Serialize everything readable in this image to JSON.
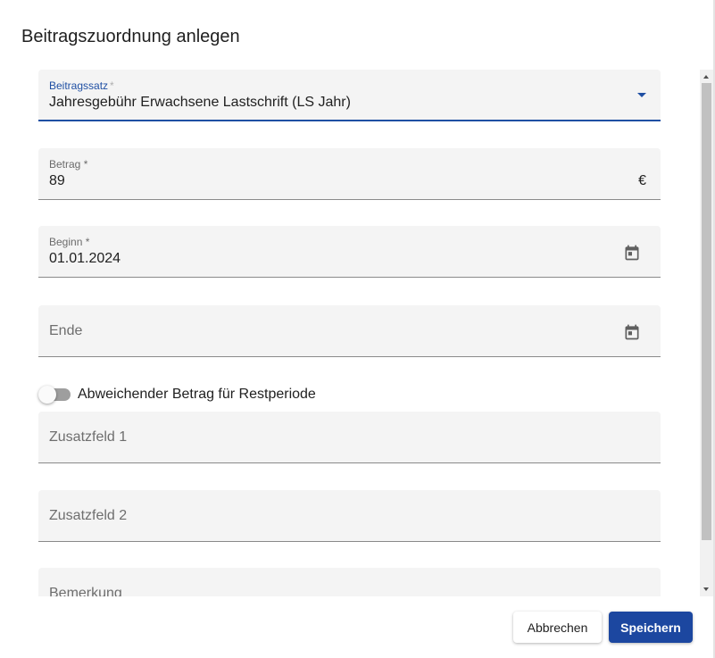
{
  "dialog": {
    "title": "Beitragszuordnung anlegen"
  },
  "fields": {
    "beitragssatz": {
      "label": "Beitragssatz",
      "required_mark": "*",
      "value": "Jahresgebühr Erwachsene Lastschrift (LS Jahr)",
      "icon": "dropdown-arrow-icon"
    },
    "betrag": {
      "label": "Betrag *",
      "value": "89",
      "suffix": "€"
    },
    "beginn": {
      "label": "Beginn *",
      "value": "01.01.2024",
      "icon": "calendar-icon"
    },
    "ende": {
      "placeholder": "Ende",
      "icon": "calendar-icon"
    },
    "zusatzfeld1": {
      "placeholder": "Zusatzfeld 1"
    },
    "zusatzfeld2": {
      "placeholder": "Zusatzfeld 2"
    },
    "bemerkung": {
      "placeholder": "Bemerkung"
    }
  },
  "toggle": {
    "label": "Abweichender Betrag für Restperiode",
    "checked": false
  },
  "actions": {
    "cancel_label": "Abbrechen",
    "save_label": "Speichern"
  },
  "colors": {
    "accent": "#1f4fa3",
    "primary_button": "#1c47a0",
    "field_background": "#f4f4f4"
  }
}
